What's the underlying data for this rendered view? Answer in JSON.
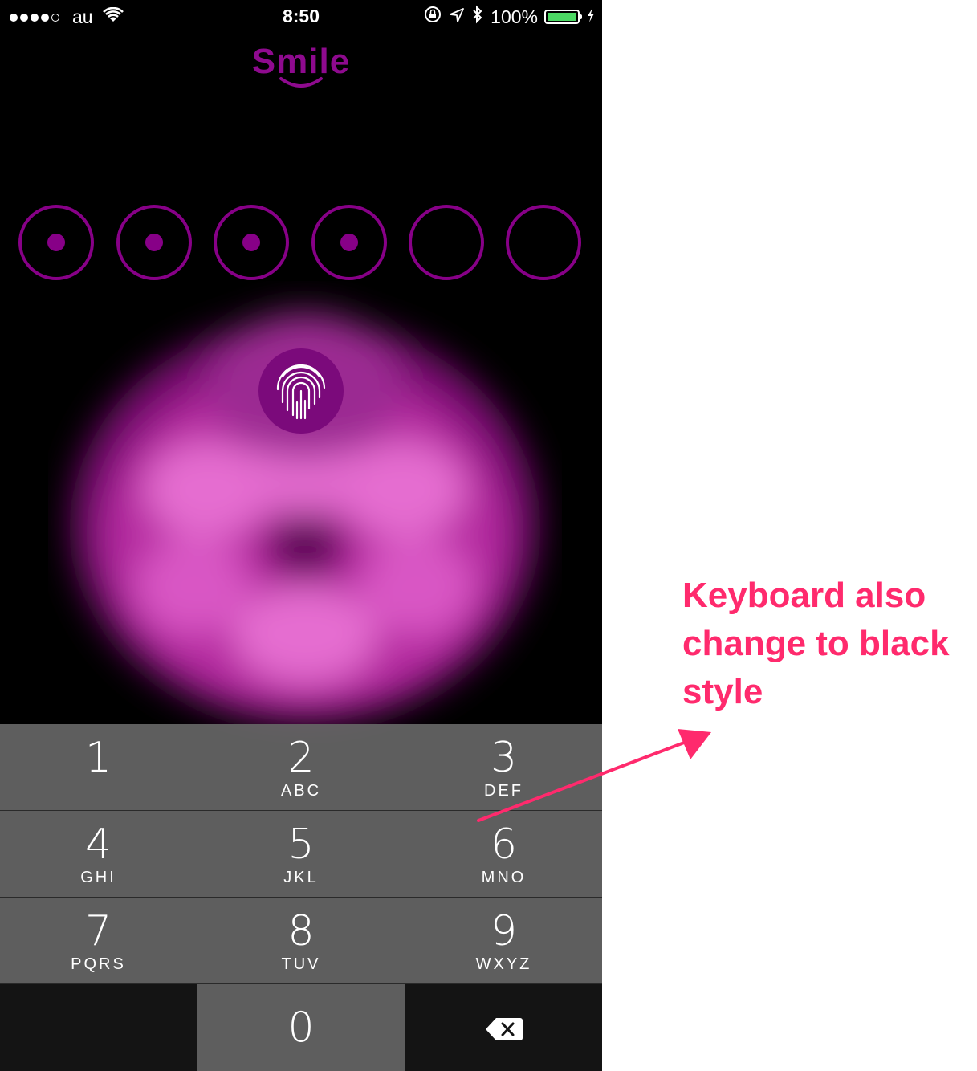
{
  "status_bar": {
    "carrier": "au",
    "time": "8:50",
    "battery": "100%",
    "signal_dots_filled": 4,
    "signal_dots_total": 5
  },
  "app": {
    "logo": "Smile"
  },
  "passcode": {
    "length": 6,
    "filled": 4,
    "accent_color": "#870087"
  },
  "touch_id": {
    "icon": "fingerprint-icon"
  },
  "keypad": {
    "keys": [
      {
        "num": "1",
        "letters": ""
      },
      {
        "num": "2",
        "letters": "ABC"
      },
      {
        "num": "3",
        "letters": "DEF"
      },
      {
        "num": "4",
        "letters": "GHI"
      },
      {
        "num": "5",
        "letters": "JKL"
      },
      {
        "num": "6",
        "letters": "MNO"
      },
      {
        "num": "7",
        "letters": "PQRS"
      },
      {
        "num": "8",
        "letters": "TUV"
      },
      {
        "num": "9",
        "letters": "WXYZ"
      },
      {
        "num": "0",
        "letters": ""
      }
    ],
    "delete_icon": "backspace-icon"
  },
  "annotation": {
    "text": "Keyboard also change to black style",
    "color": "#ff2a6d"
  }
}
